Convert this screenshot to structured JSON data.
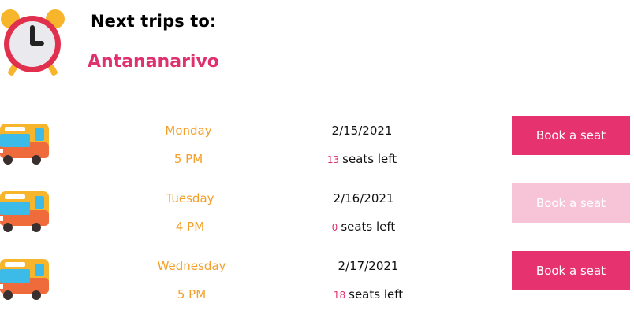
{
  "header": {
    "title": "Next trips to:",
    "destination": "Antananarivo",
    "icon": "alarm-clock-icon"
  },
  "colors": {
    "accent": "#e6336f",
    "accent_disabled": "#f7c3d6",
    "day_time": "#f3a02a"
  },
  "trips": [
    {
      "day": "Monday",
      "time": "5 PM",
      "date": "2/15/2021",
      "seats_count": "13",
      "seats_label": "seats left",
      "button_label": "Book a seat",
      "enabled": true
    },
    {
      "day": "Tuesday",
      "time": "4 PM",
      "date": "2/16/2021",
      "seats_count": "0",
      "seats_label": "seats left",
      "button_label": "Book a seat",
      "enabled": false
    },
    {
      "day": "Wednesday",
      "time": "5 PM",
      "date": "2/17/2021",
      "seats_count": "18",
      "seats_label": "seats left",
      "button_label": "Book a seat",
      "enabled": true
    }
  ]
}
